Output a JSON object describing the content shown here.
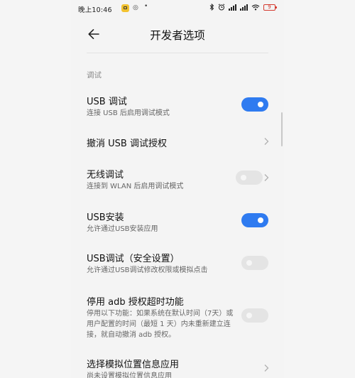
{
  "status_bar": {
    "time": "晚上10:46",
    "app_icon_2": "◎",
    "dot": "•",
    "battery_level": "9"
  },
  "header": {
    "title": "开发者选项"
  },
  "section": {
    "label": "调试"
  },
  "items": [
    {
      "title": "USB 调试",
      "subtitle": "连接 USB 后启用调试模式",
      "control": "toggle",
      "state": "on"
    },
    {
      "title": "撤消 USB 调试授权",
      "subtitle": "",
      "control": "chevron"
    },
    {
      "title": "无线调试",
      "subtitle": "连接到 WLAN 后启用调试模式",
      "control": "toggle+chevron",
      "state": "off"
    },
    {
      "title": "USB安装",
      "subtitle": "允许通过USB安装应用",
      "control": "toggle",
      "state": "on"
    },
    {
      "title": "USB调试（安全设置）",
      "subtitle": "允许通过USB调试修改权限或模拟点击",
      "control": "toggle",
      "state": "off"
    },
    {
      "title": "停用 adb 授权超时功能",
      "subtitle": "停用以下功能：如果系统在默认时间（7天）或用户配置的时间（最短 1 天）内未重新建立连接，就自动撤消 adb 授权。",
      "control": "toggle",
      "state": "off"
    },
    {
      "title": "选择模拟位置信息应用",
      "subtitle": "尚未设置模拟位置信息应用",
      "control": "chevron"
    }
  ],
  "colors": {
    "toggle_on": "#2f7bf0",
    "toggle_off": "#e4e4e4",
    "battery": "#d43a2f"
  }
}
